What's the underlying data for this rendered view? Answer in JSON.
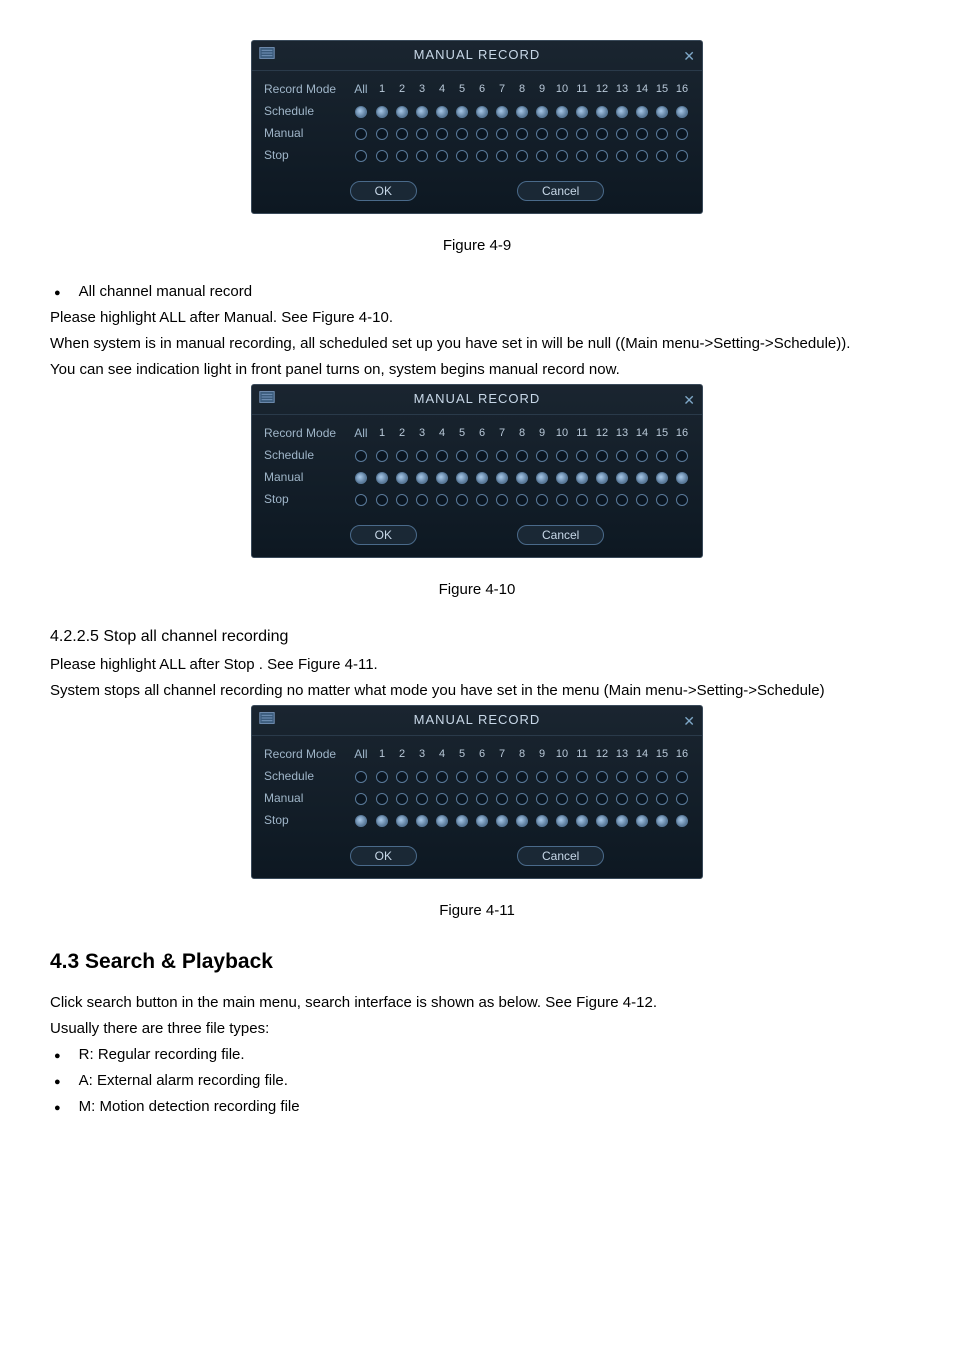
{
  "dialog": {
    "title": "MANUAL RECORD",
    "close": "✕",
    "header_label": "Record Mode",
    "all_label": "All",
    "channels": [
      "1",
      "2",
      "3",
      "4",
      "5",
      "6",
      "7",
      "8",
      "9",
      "10",
      "11",
      "12",
      "13",
      "14",
      "15",
      "16"
    ],
    "rows": {
      "schedule": "Schedule",
      "manual": "Manual",
      "stop": "Stop"
    },
    "ok": "OK",
    "cancel": "Cancel"
  },
  "captions": {
    "fig49": "Figure 4-9",
    "fig410": "Figure 4-10",
    "fig411": "Figure 4-11"
  },
  "text": {
    "bullet1": "All channel manual record",
    "p1": "Please highlight  ALL  after  Manual.  See Figure 4-10.",
    "p2": "When system is in manual recording, all scheduled set up you have set in will be null ((Main menu->Setting->Schedule)).",
    "p3": "You can see indication light in front panel turns on, system begins manual record now.",
    "sec_4225": "4.2.2.5  Stop all channel recording",
    "p4": "Please highlight  ALL  after  Stop . See Figure 4-11.",
    "p5": "System stops all channel recording no matter what mode you have set in the menu (Main menu->Setting->Schedule)",
    "h43": "4.3   Search & Playback",
    "p6": "Click search button in the main menu, search interface is shown as below. See Figure 4-12.",
    "p7": "Usually there are three file types:",
    "b_r": "R: Regular recording file.",
    "b_a": "A: External alarm recording file.",
    "b_m": "M: Motion detection recording file"
  },
  "dialog_states": {
    "fig49": {
      "all_selected": "schedule",
      "rows": {
        "schedule": "filled",
        "manual": "empty",
        "stop": "empty"
      }
    },
    "fig410": {
      "all_selected": "manual",
      "rows": {
        "schedule": "empty",
        "manual": "filled",
        "stop": "empty"
      }
    },
    "fig411": {
      "all_selected": "stop",
      "rows": {
        "schedule": "empty",
        "manual": "empty",
        "stop": "filled"
      }
    }
  }
}
